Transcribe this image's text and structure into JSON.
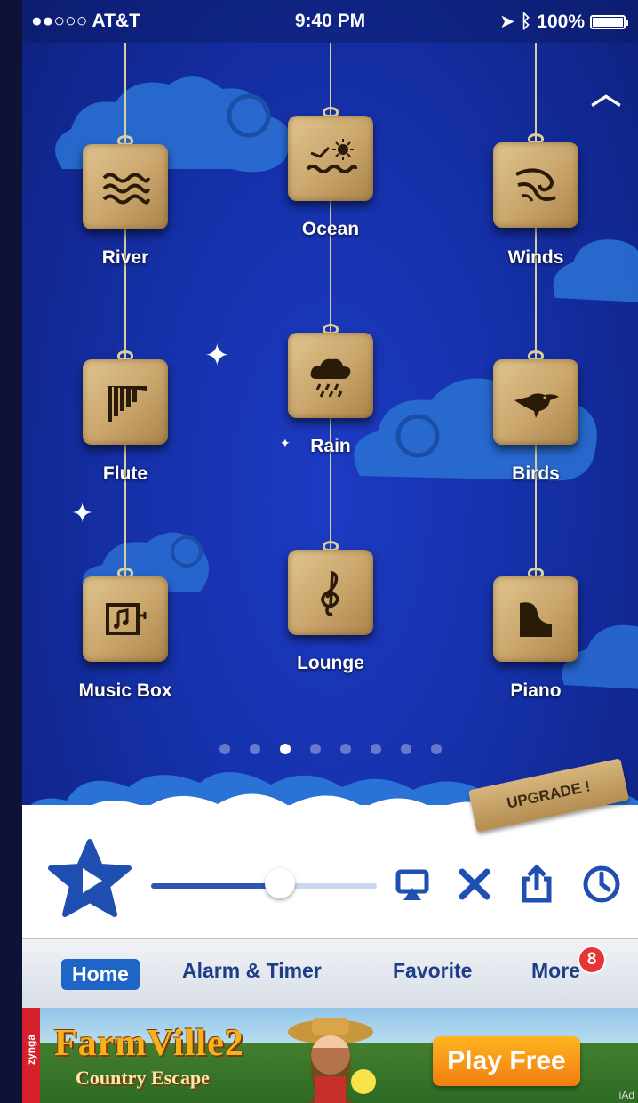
{
  "status_bar": {
    "carrier": "●●○○○ AT&T",
    "time": "9:40 PM",
    "battery": "100%"
  },
  "sounds": [
    {
      "label": "River",
      "icon": "waves-icon"
    },
    {
      "label": "Ocean",
      "icon": "sun-waves-icon"
    },
    {
      "label": "Winds",
      "icon": "wind-swirl-icon"
    },
    {
      "label": "Flute",
      "icon": "pan-flute-icon"
    },
    {
      "label": "Rain",
      "icon": "rain-cloud-icon"
    },
    {
      "label": "Birds",
      "icon": "bird-icon"
    },
    {
      "label": "Music Box",
      "icon": "music-box-icon"
    },
    {
      "label": "Lounge",
      "icon": "treble-clef-icon"
    },
    {
      "label": "Piano",
      "icon": "grand-piano-icon"
    }
  ],
  "pager": {
    "count": 8,
    "active_index": 2
  },
  "upgrade_label": "UPGRADE !",
  "player": {
    "volume_fraction": 0.57,
    "accent_color": "#1f4fb0"
  },
  "tabs": {
    "home": "Home",
    "alarm": "Alarm & Timer",
    "favorite": "Favorite",
    "more": "More",
    "more_badge": "8"
  },
  "ad": {
    "brand": "zynga",
    "title": "FarmVille2",
    "subtitle": "Country Escape",
    "cta": "Play Free",
    "tag": "iAd"
  }
}
